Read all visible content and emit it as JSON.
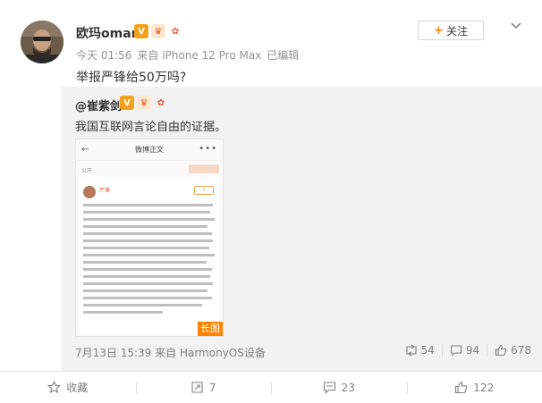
{
  "post": {
    "username": "欧玛omar",
    "badges": [
      "verified",
      "crown",
      "medal"
    ],
    "follow_label": "关注",
    "time": "今天 01:56",
    "source": "来自 iPhone 12 Pro Max",
    "edited": "已编辑",
    "text": "举报严锋给50万吗?"
  },
  "repost": {
    "username": "@崔紫剑",
    "text": "我国互联网言论自由的证据。",
    "image": {
      "page_title": "微博正文",
      "sub_label": "公开",
      "author": "严锋",
      "tag": "长图"
    },
    "time": "7月13日 15:39",
    "source": "来自 HarmonyOS设备",
    "reposts": "54",
    "comments": "94",
    "likes": "678"
  },
  "actions": {
    "favorite": "收藏",
    "repost_count": "7",
    "comment_count": "23",
    "like_count": "122"
  },
  "colors": {
    "accent": "#ff8200",
    "meta_text": "#939393",
    "repost_bg": "#f2f2f2"
  }
}
